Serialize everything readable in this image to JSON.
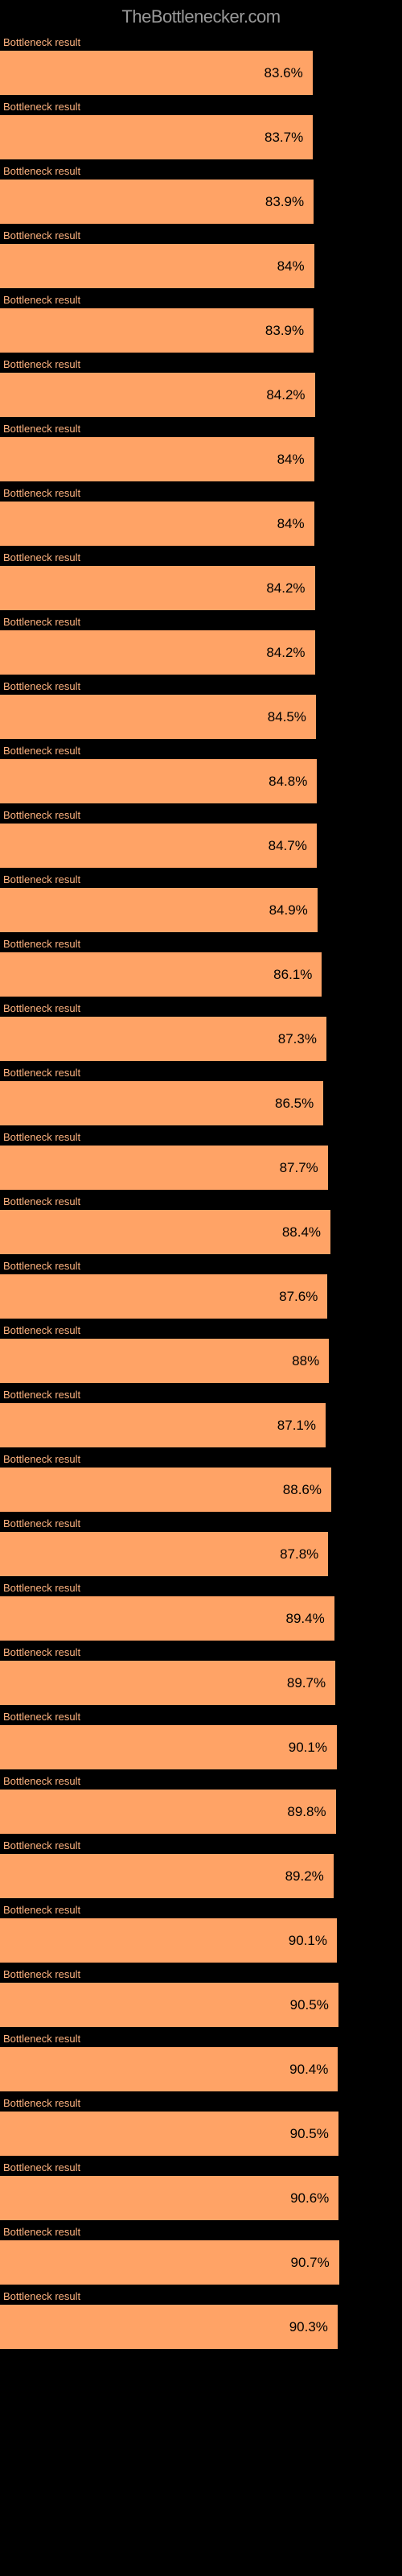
{
  "header": {
    "logo": "TheBottlenecker.com"
  },
  "chart_data": {
    "type": "bar",
    "title": "",
    "xlabel": "",
    "ylabel": "",
    "max_width_percent": 93,
    "bars": [
      {
        "label": "Bottleneck result",
        "value": 83.6,
        "display": "83.6%"
      },
      {
        "label": "Bottleneck result",
        "value": 83.7,
        "display": "83.7%"
      },
      {
        "label": "Bottleneck result",
        "value": 83.9,
        "display": "83.9%"
      },
      {
        "label": "Bottleneck result",
        "value": 84.0,
        "display": "84%"
      },
      {
        "label": "Bottleneck result",
        "value": 83.9,
        "display": "83.9%"
      },
      {
        "label": "Bottleneck result",
        "value": 84.2,
        "display": "84.2%"
      },
      {
        "label": "Bottleneck result",
        "value": 84.0,
        "display": "84%"
      },
      {
        "label": "Bottleneck result",
        "value": 84.0,
        "display": "84%"
      },
      {
        "label": "Bottleneck result",
        "value": 84.2,
        "display": "84.2%"
      },
      {
        "label": "Bottleneck result",
        "value": 84.2,
        "display": "84.2%"
      },
      {
        "label": "Bottleneck result",
        "value": 84.5,
        "display": "84.5%"
      },
      {
        "label": "Bottleneck result",
        "value": 84.8,
        "display": "84.8%"
      },
      {
        "label": "Bottleneck result",
        "value": 84.7,
        "display": "84.7%"
      },
      {
        "label": "Bottleneck result",
        "value": 84.9,
        "display": "84.9%"
      },
      {
        "label": "Bottleneck result",
        "value": 86.1,
        "display": "86.1%"
      },
      {
        "label": "Bottleneck result",
        "value": 87.3,
        "display": "87.3%"
      },
      {
        "label": "Bottleneck result",
        "value": 86.5,
        "display": "86.5%"
      },
      {
        "label": "Bottleneck result",
        "value": 87.7,
        "display": "87.7%"
      },
      {
        "label": "Bottleneck result",
        "value": 88.4,
        "display": "88.4%"
      },
      {
        "label": "Bottleneck result",
        "value": 87.6,
        "display": "87.6%"
      },
      {
        "label": "Bottleneck result",
        "value": 88.0,
        "display": "88%"
      },
      {
        "label": "Bottleneck result",
        "value": 87.1,
        "display": "87.1%"
      },
      {
        "label": "Bottleneck result",
        "value": 88.6,
        "display": "88.6%"
      },
      {
        "label": "Bottleneck result",
        "value": 87.8,
        "display": "87.8%"
      },
      {
        "label": "Bottleneck result",
        "value": 89.4,
        "display": "89.4%"
      },
      {
        "label": "Bottleneck result",
        "value": 89.7,
        "display": "89.7%"
      },
      {
        "label": "Bottleneck result",
        "value": 90.1,
        "display": "90.1%"
      },
      {
        "label": "Bottleneck result",
        "value": 89.8,
        "display": "89.8%"
      },
      {
        "label": "Bottleneck result",
        "value": 89.2,
        "display": "89.2%"
      },
      {
        "label": "Bottleneck result",
        "value": 90.1,
        "display": "90.1%"
      },
      {
        "label": "Bottleneck result",
        "value": 90.5,
        "display": "90.5%"
      },
      {
        "label": "Bottleneck result",
        "value": 90.4,
        "display": "90.4%"
      },
      {
        "label": "Bottleneck result",
        "value": 90.5,
        "display": "90.5%"
      },
      {
        "label": "Bottleneck result",
        "value": 90.6,
        "display": "90.6%"
      },
      {
        "label": "Bottleneck result",
        "value": 90.7,
        "display": "90.7%"
      },
      {
        "label": "Bottleneck result",
        "value": 90.3,
        "display": "90.3%"
      }
    ]
  }
}
